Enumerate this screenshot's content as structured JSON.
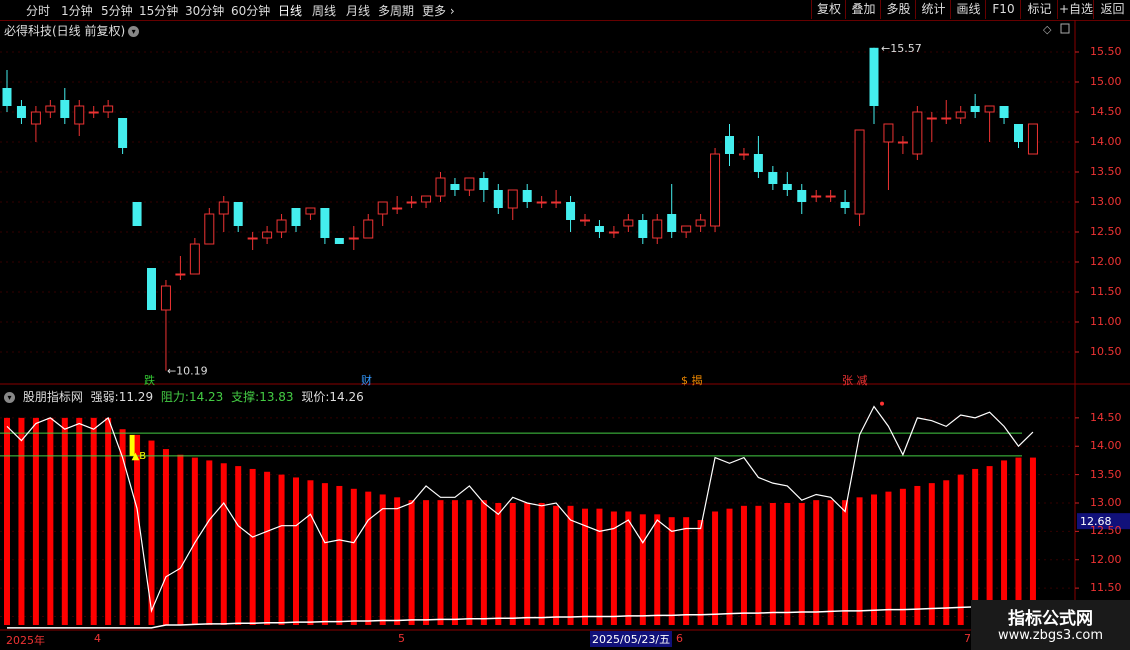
{
  "topbar": {
    "timeframes": [
      "分时",
      "1分钟",
      "5分钟",
      "15分钟",
      "30分钟",
      "60分钟",
      "日线",
      "周线",
      "月线",
      "多周期",
      "更多"
    ],
    "active": "日线",
    "right_buttons": [
      "复权",
      "叠加",
      "多股",
      "统计",
      "画线",
      "F10",
      "标记",
      "+自选",
      "返回"
    ]
  },
  "stock": {
    "title": "必得科技(日线 前复权)"
  },
  "price_axis": {
    "labels": [
      "15.50",
      "15.00",
      "14.50",
      "14.00",
      "13.50",
      "13.00",
      "12.50",
      "12.00",
      "11.50",
      "11.00",
      "10.50"
    ]
  },
  "markers": {
    "high": "15.57",
    "low": "10.19",
    "buy": "B"
  },
  "events": [
    {
      "label": "跌",
      "color": "#3c3"
    },
    {
      "label": "财",
      "color": "#39f"
    },
    {
      "label": "$ 揭",
      "color": "#e80"
    },
    {
      "label": "张 减",
      "color": "#e33"
    }
  ],
  "indicator": {
    "name": "股朋指标网",
    "strength_label": "强弱:",
    "strength_value": "11.29",
    "resist_label": "阻力:",
    "resist_value": "14.23",
    "support_label": "支撑:",
    "support_value": "13.83",
    "price_label": "现价:",
    "price_value": "14.26",
    "axis_labels": [
      "14.50",
      "14.00",
      "13.50",
      "13.00",
      "12.50",
      "12.00",
      "11.50",
      "11.00"
    ],
    "current_badge": "12.68"
  },
  "dates": {
    "year": "2025年",
    "m4": "4",
    "m5": "5",
    "highlight": "2025/05/23/五",
    "m6": "6",
    "m7": "7"
  },
  "watermark": {
    "line1": "指标公式网",
    "line2": "www.zbgs3.com"
  },
  "colors": {
    "up": "#e33",
    "down": "#4ee",
    "resist": "#4c4",
    "bar": "#f00",
    "line": "#fff"
  },
  "chart_data": {
    "type": "candlestick",
    "ohlc": [
      [
        14.9,
        15.2,
        14.5,
        14.6
      ],
      [
        14.6,
        14.7,
        14.3,
        14.4
      ],
      [
        14.3,
        14.6,
        14.0,
        14.5
      ],
      [
        14.5,
        14.7,
        14.4,
        14.6
      ],
      [
        14.7,
        14.9,
        14.3,
        14.4
      ],
      [
        14.3,
        14.7,
        14.1,
        14.6
      ],
      [
        14.5,
        14.6,
        14.4,
        14.5
      ],
      [
        14.5,
        14.7,
        14.4,
        14.6
      ],
      [
        14.4,
        14.4,
        13.8,
        13.9
      ],
      [
        13.0,
        13.0,
        12.6,
        12.6
      ],
      [
        11.9,
        11.9,
        11.2,
        11.2
      ],
      [
        11.2,
        11.7,
        10.19,
        11.6
      ],
      [
        11.8,
        12.1,
        11.7,
        11.8
      ],
      [
        11.8,
        12.4,
        11.8,
        12.3
      ],
      [
        12.3,
        12.9,
        12.3,
        12.8
      ],
      [
        12.8,
        13.1,
        12.5,
        13.0
      ],
      [
        13.0,
        13.0,
        12.5,
        12.6
      ],
      [
        12.4,
        12.5,
        12.2,
        12.4
      ],
      [
        12.4,
        12.6,
        12.3,
        12.5
      ],
      [
        12.5,
        12.8,
        12.4,
        12.7
      ],
      [
        12.9,
        12.9,
        12.5,
        12.6
      ],
      [
        12.8,
        12.9,
        12.7,
        12.9
      ],
      [
        12.9,
        12.9,
        12.3,
        12.4
      ],
      [
        12.4,
        12.4,
        12.3,
        12.3
      ],
      [
        12.4,
        12.6,
        12.2,
        12.4
      ],
      [
        12.4,
        12.8,
        12.4,
        12.7
      ],
      [
        12.8,
        13.0,
        12.6,
        13.0
      ],
      [
        12.9,
        13.1,
        12.8,
        12.9
      ],
      [
        13.0,
        13.1,
        12.9,
        13.0
      ],
      [
        13.0,
        13.1,
        12.9,
        13.1
      ],
      [
        13.1,
        13.5,
        13.0,
        13.4
      ],
      [
        13.3,
        13.4,
        13.1,
        13.2
      ],
      [
        13.2,
        13.4,
        13.1,
        13.4
      ],
      [
        13.4,
        13.5,
        13.0,
        13.2
      ],
      [
        13.2,
        13.3,
        12.8,
        12.9
      ],
      [
        12.9,
        13.2,
        12.7,
        13.2
      ],
      [
        13.2,
        13.3,
        12.9,
        13.0
      ],
      [
        13.0,
        13.1,
        12.9,
        13.0
      ],
      [
        13.0,
        13.2,
        12.9,
        13.0
      ],
      [
        13.0,
        13.1,
        12.5,
        12.7
      ],
      [
        12.7,
        12.8,
        12.6,
        12.7
      ],
      [
        12.6,
        12.7,
        12.4,
        12.5
      ],
      [
        12.5,
        12.6,
        12.4,
        12.5
      ],
      [
        12.6,
        12.8,
        12.5,
        12.7
      ],
      [
        12.7,
        12.8,
        12.3,
        12.4
      ],
      [
        12.4,
        12.8,
        12.3,
        12.7
      ],
      [
        12.8,
        13.3,
        12.4,
        12.5
      ],
      [
        12.5,
        12.6,
        12.4,
        12.6
      ],
      [
        12.6,
        12.8,
        12.5,
        12.7
      ],
      [
        12.6,
        13.9,
        12.5,
        13.8
      ],
      [
        14.1,
        14.3,
        13.6,
        13.8
      ],
      [
        13.8,
        13.9,
        13.7,
        13.8
      ],
      [
        13.8,
        14.1,
        13.4,
        13.5
      ],
      [
        13.5,
        13.6,
        13.2,
        13.3
      ],
      [
        13.3,
        13.5,
        13.1,
        13.2
      ],
      [
        13.2,
        13.3,
        12.8,
        13.0
      ],
      [
        13.1,
        13.2,
        13.0,
        13.1
      ],
      [
        13.1,
        13.2,
        13.0,
        13.1
      ],
      [
        13.0,
        13.2,
        12.8,
        12.9
      ],
      [
        12.8,
        14.2,
        12.6,
        14.2
      ],
      [
        15.57,
        15.57,
        14.3,
        14.6
      ],
      [
        14.0,
        14.3,
        13.2,
        14.3
      ],
      [
        14.0,
        14.1,
        13.8,
        14.0
      ],
      [
        13.8,
        14.6,
        13.7,
        14.5
      ],
      [
        14.4,
        14.5,
        14.0,
        14.4
      ],
      [
        14.4,
        14.7,
        14.3,
        14.4
      ],
      [
        14.4,
        14.6,
        14.3,
        14.5
      ],
      [
        14.6,
        14.8,
        14.4,
        14.5
      ],
      [
        14.5,
        14.6,
        14.0,
        14.6
      ],
      [
        14.6,
        14.6,
        14.3,
        14.4
      ],
      [
        14.3,
        14.3,
        13.9,
        14.0
      ],
      [
        13.8,
        14.3,
        13.8,
        14.3
      ]
    ],
    "indicator_bars": [
      14.5,
      14.5,
      14.5,
      14.5,
      14.5,
      14.5,
      14.5,
      14.5,
      14.3,
      14.2,
      14.1,
      13.95,
      13.85,
      13.8,
      13.75,
      13.7,
      13.65,
      13.6,
      13.55,
      13.5,
      13.45,
      13.4,
      13.35,
      13.3,
      13.25,
      13.2,
      13.15,
      13.1,
      13.05,
      13.05,
      13.05,
      13.05,
      13.05,
      13.05,
      13.0,
      13.0,
      13.0,
      13.0,
      12.95,
      12.95,
      12.9,
      12.9,
      12.85,
      12.85,
      12.8,
      12.8,
      12.75,
      12.75,
      12.7,
      12.85,
      12.9,
      12.95,
      12.95,
      13.0,
      13.0,
      13.0,
      13.05,
      13.05,
      13.05,
      13.1,
      13.15,
      13.2,
      13.25,
      13.3,
      13.35,
      13.4,
      13.5,
      13.6,
      13.65,
      13.75,
      13.8,
      13.8
    ],
    "close_line": [
      14.35,
      14.1,
      14.4,
      14.5,
      14.3,
      14.4,
      14.3,
      14.5,
      13.8,
      12.9,
      11.1,
      11.7,
      11.85,
      12.3,
      12.7,
      13.0,
      12.6,
      12.4,
      12.5,
      12.6,
      12.6,
      12.8,
      12.3,
      12.35,
      12.3,
      12.7,
      12.9,
      12.9,
      13.0,
      13.3,
      13.1,
      13.1,
      13.3,
      13.0,
      12.8,
      13.1,
      13.0,
      12.95,
      13.0,
      12.7,
      12.6,
      12.5,
      12.55,
      12.7,
      12.3,
      12.7,
      12.5,
      12.55,
      12.55,
      13.8,
      13.7,
      13.8,
      13.45,
      13.35,
      13.3,
      13.05,
      13.15,
      13.1,
      12.85,
      14.2,
      14.7,
      14.35,
      13.85,
      14.5,
      14.45,
      14.35,
      14.55,
      14.5,
      14.6,
      14.35,
      14.0,
      14.25
    ],
    "bottom_line": [
      10.8,
      10.8,
      10.8,
      10.8,
      10.8,
      10.8,
      10.8,
      10.8,
      10.8,
      10.8,
      10.8,
      10.85,
      10.85,
      10.86,
      10.87,
      10.87,
      10.88,
      10.88,
      10.89,
      10.89,
      10.9,
      10.9,
      10.91,
      10.91,
      10.92,
      10.92,
      10.93,
      10.93,
      10.94,
      10.94,
      10.95,
      10.95,
      10.96,
      10.96,
      10.97,
      10.97,
      10.98,
      10.98,
      10.99,
      10.99,
      11.0,
      11.0,
      11.0,
      11.01,
      11.01,
      11.02,
      11.02,
      11.03,
      11.03,
      11.04,
      11.05,
      11.06,
      11.06,
      11.07,
      11.07,
      11.08,
      11.08,
      11.09,
      11.1,
      11.1,
      11.11,
      11.12,
      11.12,
      11.13,
      11.14,
      11.15,
      11.16,
      11.17,
      11.18,
      11.19,
      11.2,
      11.21
    ],
    "resistance": 14.23,
    "support": 13.83,
    "price_range": [
      10.2,
      15.75
    ],
    "indicator_range": [
      10.85,
      14.85
    ]
  }
}
